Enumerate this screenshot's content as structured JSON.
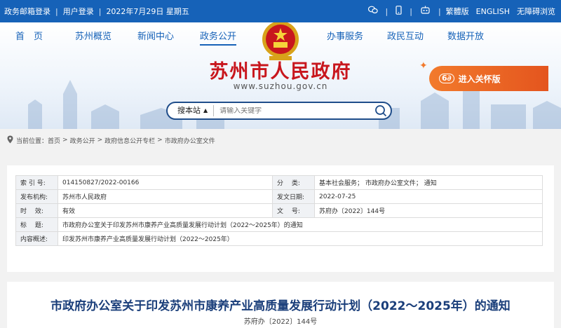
{
  "topbar": {
    "mail_login": "政务邮箱登录",
    "user_login": "用户登录",
    "date": "2022年7月29日 星期五",
    "traditional": "繁體版",
    "english": "ENGLISH",
    "accessible": "无障碍浏览",
    "icons": [
      "wechat-icon",
      "mobile-icon",
      "robot-icon"
    ]
  },
  "nav": {
    "items": [
      "首　页",
      "苏州概览",
      "新闻中心",
      "政务公开",
      "办事服务",
      "政民互动",
      "数据开放"
    ],
    "active_index": 3
  },
  "site": {
    "title": "苏州市人民政府",
    "url": "www.suzhou.gov.cn",
    "care_label": "进入关怀版",
    "glasses_icon": "6∂"
  },
  "search": {
    "scope": "搜本站",
    "placeholder": "请输入关键字"
  },
  "breadcrumb": {
    "prefix": "当前位置：",
    "items": [
      "首页",
      "政务公开",
      "政府信息公开专栏",
      "市政府办公室文件"
    ]
  },
  "meta": {
    "index_label": "索 引 号:",
    "index_value": "014150827/2022-00166",
    "category_label": "分　 类:",
    "category_value": "基本社会服务； 市政府办公室文件； 通知",
    "publisher_label": "发布机构:",
    "publisher_value": "苏州市人民政府",
    "date_label": "发文日期:",
    "date_value": "2022-07-25",
    "validity_label": "时　 效:",
    "validity_value": "有效",
    "docno_label": "文　 号:",
    "docno_value": "苏府办〔2022〕144号",
    "title_label": "标　 题:",
    "title_value": "市政府办公室关于印发苏州市康养产业高质量发展行动计划（2022～2025年）的通知",
    "summary_label": "内容概述:",
    "summary_value": "印发苏州市康养产业高质量发展行动计划（2022～2025年）"
  },
  "article": {
    "title": "市政府办公室关于印发苏州市康养产业高质量发展行动计划（2022～2025年）的通知",
    "doc_no": "苏府办〔2022〕144号"
  },
  "colors": {
    "brand_blue": "#1662b8",
    "title_red": "#c8161d",
    "care_orange": "#f27a2c",
    "article_title": "#1a3e7a"
  }
}
